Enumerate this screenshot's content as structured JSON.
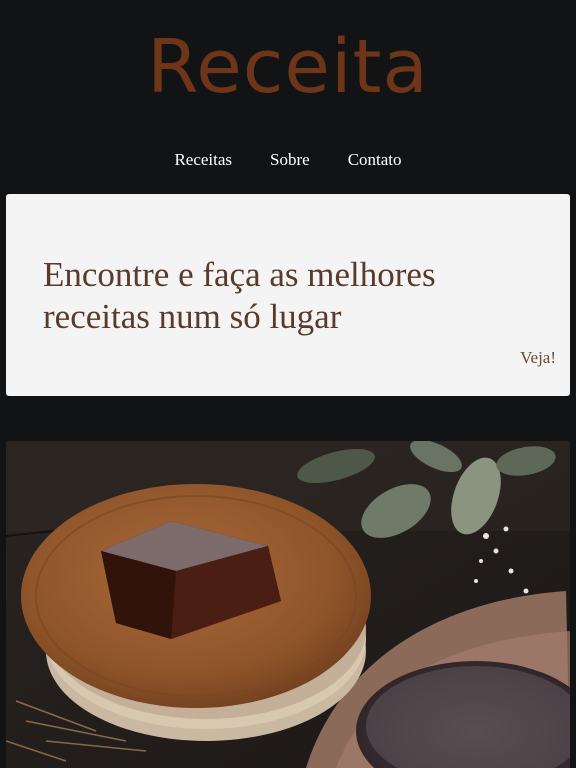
{
  "header": {
    "logo": "Receita",
    "nav": [
      "Receitas",
      "Sobre",
      "Contato"
    ]
  },
  "hero": {
    "title": "Encontre e faça as melhores receitas num só lugar",
    "link": "Veja!"
  },
  "colors": {
    "background": "#121314",
    "logo": "#6e3519",
    "hero_bg": "#f4f4f4",
    "hero_text": "#5a3a2a"
  },
  "photo": {
    "subject": "chocolate-cake-photo"
  }
}
